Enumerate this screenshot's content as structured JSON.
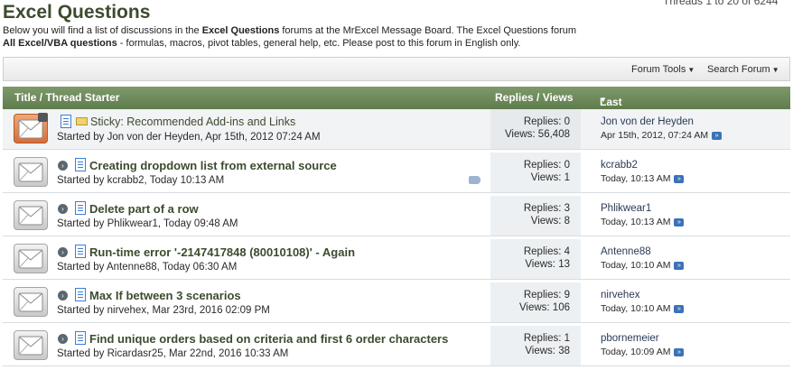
{
  "page": {
    "title": "Excel Questions",
    "threads_count": "Threads 1 to 20 of 6244",
    "description_line1_pre": "Below you will find a list of discussions in the ",
    "description_line1_bold": "Excel Questions",
    "description_line1_post": " forums at the MrExcel Message Board. The Excel Questions forum",
    "description_line2_bold": "All Excel/VBA questions",
    "description_line2_post": " - formulas, macros, pivot tables, general help, etc. Please post to this forum in English only."
  },
  "toolbar": {
    "forum_tools": "Forum Tools",
    "search_forum": "Search Forum"
  },
  "header": {
    "title_col": "Title / Thread Starter",
    "replies_col": "Replies / Views",
    "last_post_col": "Last Post By"
  },
  "threads": [
    {
      "title": "Sticky: Recommended Add-ins and Links",
      "starter": "Started by Jon von der Heyden, Apr 15th, 2012 07:24 AM",
      "replies": "Replies: 0",
      "views": "Views: 56,408",
      "last_user": "Jon von der Heyden",
      "last_time": "Apr 15th, 2012, 07:24 AM"
    },
    {
      "title": "Creating dropdown list from external source",
      "starter": "Started by kcrabb2, Today 10:13 AM",
      "replies": "Replies: 0",
      "views": "Views: 1",
      "last_user": "kcrabb2",
      "last_time": "Today, 10:13 AM"
    },
    {
      "title": "Delete part of a row",
      "starter": "Started by Phlikwear1, Today 09:48 AM",
      "replies": "Replies: 3",
      "views": "Views: 8",
      "last_user": "Phlikwear1",
      "last_time": "Today, 10:13 AM"
    },
    {
      "title": "Run-time error '-2147417848 (80010108)' - Again",
      "starter": "Started by Antenne88, Today 06:30 AM",
      "replies": "Replies: 4",
      "views": "Views: 13",
      "last_user": "Antenne88",
      "last_time": "Today, 10:10 AM"
    },
    {
      "title": "Max If between 3 scenarios",
      "starter": "Started by nirvehex, Mar 23rd, 2016 02:09 PM",
      "replies": "Replies: 9",
      "views": "Views: 106",
      "last_user": "nirvehex",
      "last_time": "Today, 10:10 AM"
    },
    {
      "title": "Find unique orders based on criteria and first 6 order characters",
      "starter": "Started by Ricardasr25, Mar 22nd, 2016 10:33 AM",
      "replies": "Replies: 1",
      "views": "Views: 38",
      "last_user": "pbornemeier",
      "last_time": "Today, 10:09 AM"
    }
  ],
  "icons": {
    "envelope": "envelope-icon",
    "sticky_envelope": "envelope-hot-icon",
    "lock": "lock-icon",
    "doc": "document-icon",
    "tag": "tag-icon",
    "go": "go-to-last-post-icon"
  },
  "colors": {
    "header_bg": "#6b8858",
    "title_text": "#3c4b2e",
    "stats_bg": "#edf0f2",
    "sticky_icon": "#d86d38"
  }
}
